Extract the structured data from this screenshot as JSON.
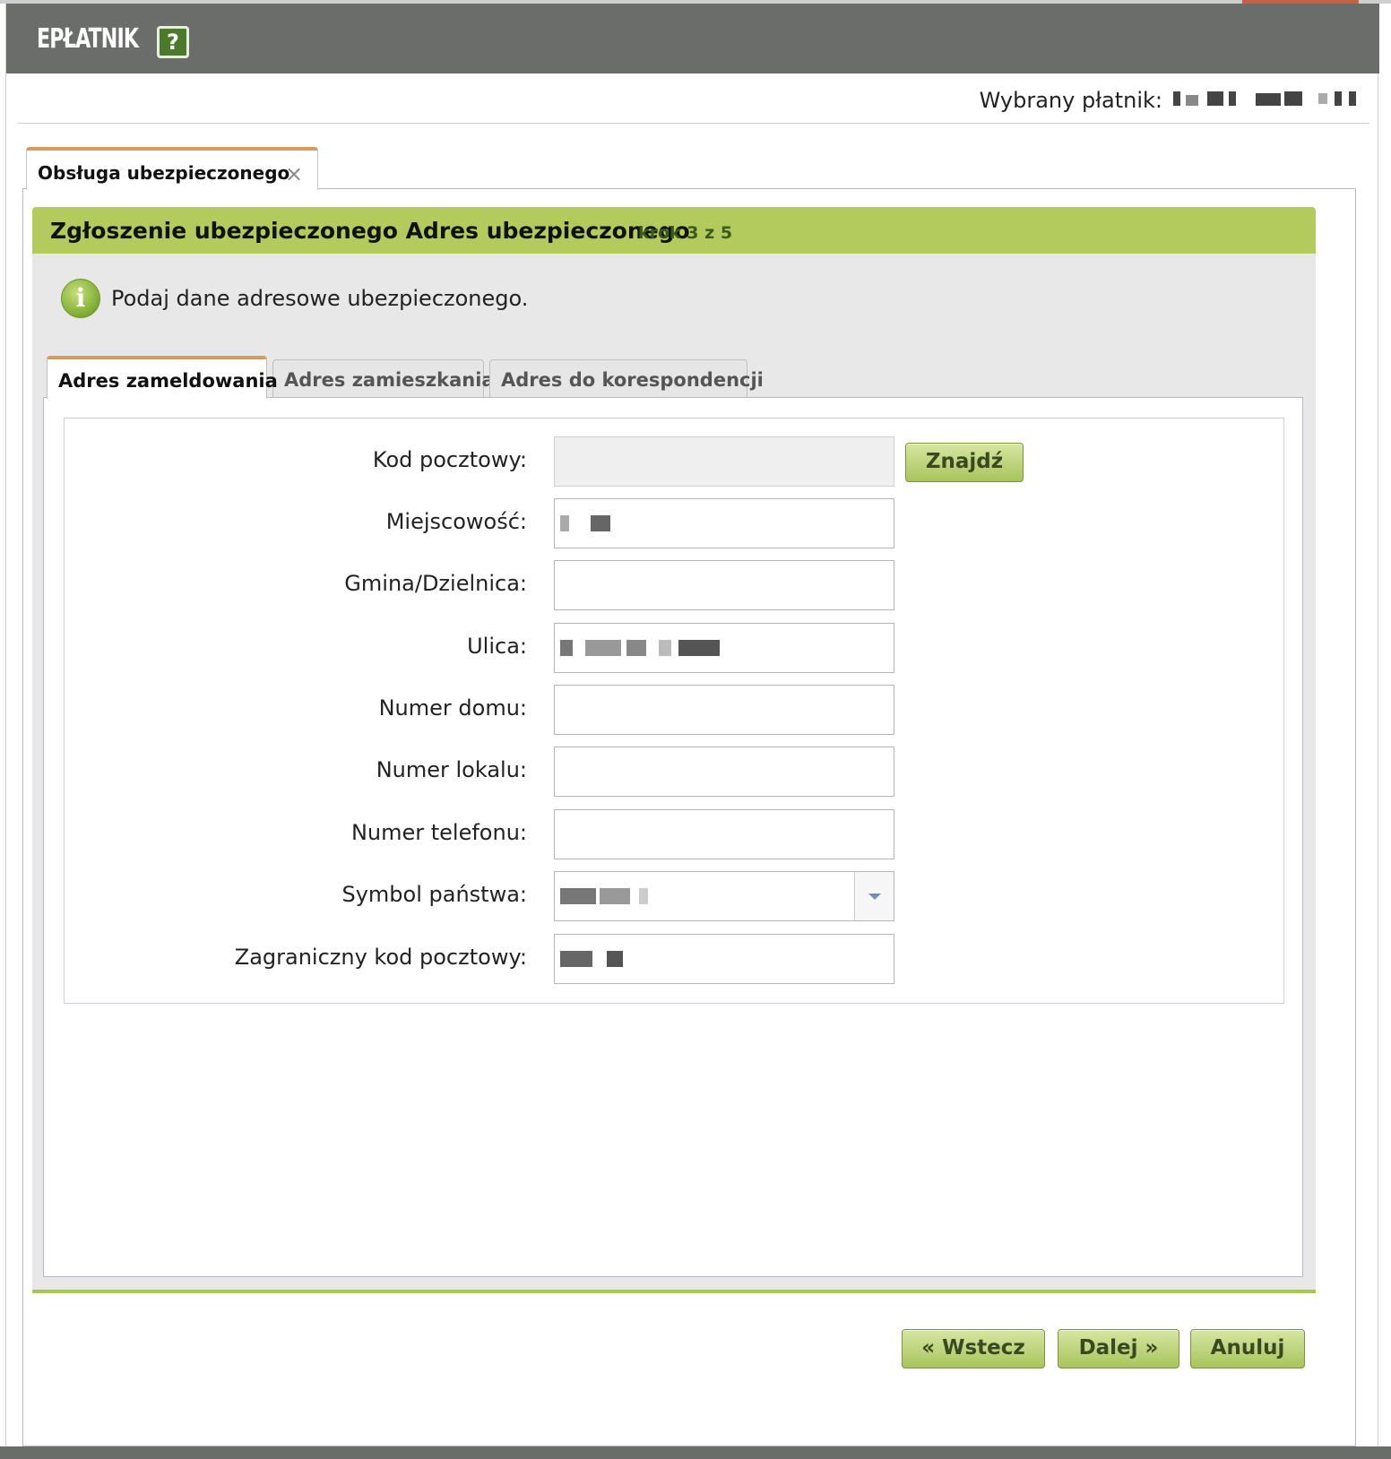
{
  "app": {
    "title": "EPŁATNIK",
    "help_label": "?"
  },
  "payer": {
    "label": "Wybrany płatnik:"
  },
  "outer_tab": {
    "label": "Obsługa ubezpieczonego",
    "close": "×"
  },
  "step": {
    "title": "Zgłoszenie ubezpieczonego Adres ubezpieczonego",
    "counter": "krok 3 z 5"
  },
  "info": {
    "icon_glyph": "i",
    "text": "Podaj dane adresowe ubezpieczonego."
  },
  "tabs": [
    {
      "label": "Adres zameldowania",
      "active": true
    },
    {
      "label": "Adres zamieszkania",
      "active": false
    },
    {
      "label": "Adres do korespondencji",
      "active": false
    }
  ],
  "form": {
    "postal_code": {
      "label": "Kod pocztowy:",
      "value": ""
    },
    "find_button": "Znajdź",
    "city": {
      "label": "Miejscowość:"
    },
    "district": {
      "label": "Gmina/Dzielnica:",
      "value": ""
    },
    "street": {
      "label": "Ulica:"
    },
    "house_number": {
      "label": "Numer domu:",
      "value": ""
    },
    "apartment_number": {
      "label": "Numer lokalu:",
      "value": ""
    },
    "phone": {
      "label": "Numer telefonu:",
      "value": ""
    },
    "country_symbol": {
      "label": "Symbol państwa:"
    },
    "foreign_postal_code": {
      "label": "Zagraniczny kod pocztowy:"
    }
  },
  "footer": {
    "back": "« Wstecz",
    "next": "Dalej »",
    "cancel": "Anuluj"
  },
  "colors": {
    "titlebar": "#6b6d6b",
    "step_header": "#b2cb5c",
    "tab_accent": "#d79a5c",
    "button": "#a9c45c"
  }
}
